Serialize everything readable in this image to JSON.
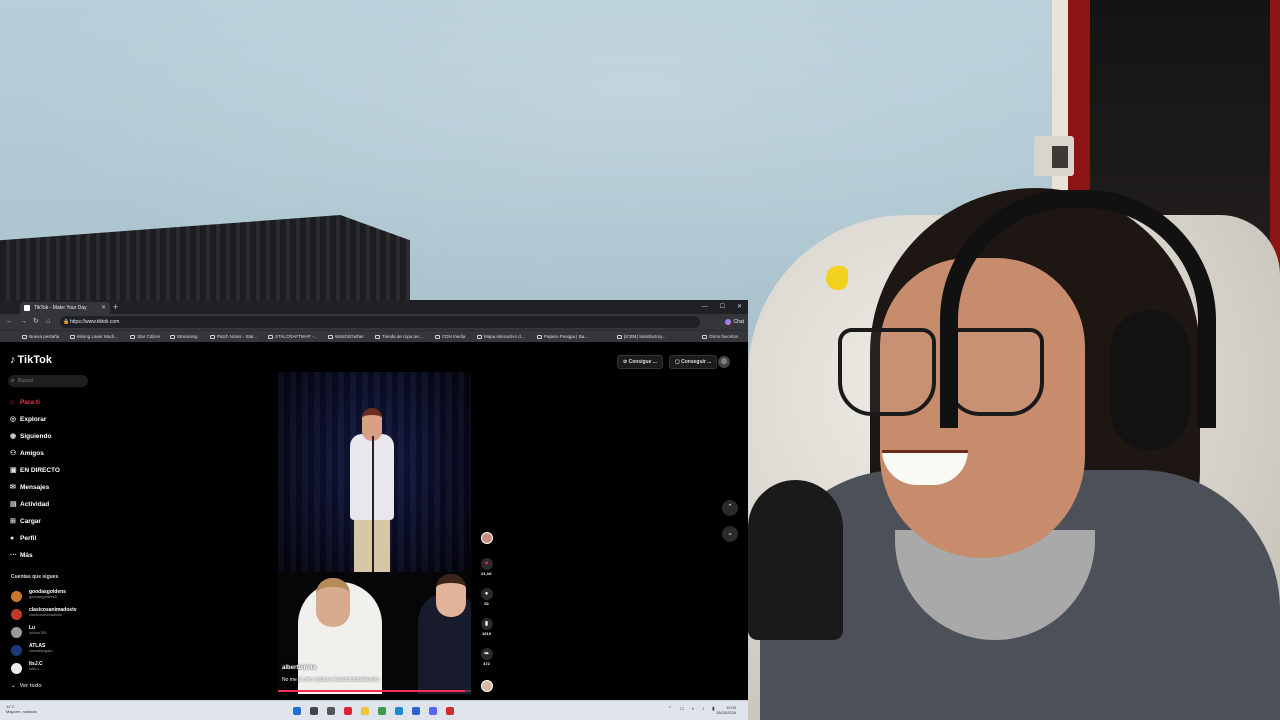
{
  "browser": {
    "tab_title": "TikTok - Make Your Day",
    "tab_close": "✕",
    "new_tab": "+",
    "url": "https://www.tiktok.com",
    "chat_label": "Chat",
    "window_controls": [
      "—",
      "☐",
      "✕"
    ],
    "bookmarks": [
      "Nueva pestaña",
      "Mining Laser Modi...",
      "Star Citizen",
      "Streaming",
      "Patch Notes - Star...",
      "STALCRAFTMAP -...",
      "Watch2Gether",
      "Tienda de ropa tec...",
      "CDN media",
      "Mapa interactivo d...",
      "Papero Pesqpa | Ba...",
      "[ICBM] Satisfactory...",
      "Otros favoritos"
    ]
  },
  "tiktok": {
    "logo": "TikTok",
    "search_placeholder": "Buscar",
    "nav": [
      {
        "label": "Para ti",
        "icon": "home-icon",
        "glyph": "⌂",
        "active": true
      },
      {
        "label": "Explorar",
        "icon": "compass-icon",
        "glyph": "◎",
        "active": false
      },
      {
        "label": "Siguiendo",
        "icon": "following-icon",
        "glyph": "◉",
        "active": false
      },
      {
        "label": "Amigos",
        "icon": "friends-icon",
        "glyph": "⚇",
        "active": false
      },
      {
        "label": "EN DIRECTO",
        "icon": "live-icon",
        "glyph": "▣",
        "active": false
      },
      {
        "label": "Mensajes",
        "icon": "messages-icon",
        "glyph": "✉",
        "active": false
      },
      {
        "label": "Actividad",
        "icon": "activity-icon",
        "glyph": "▤",
        "active": false
      },
      {
        "label": "Cargar",
        "icon": "upload-icon",
        "glyph": "⊞",
        "active": false
      },
      {
        "label": "Perfil",
        "icon": "profile-icon",
        "glyph": "●",
        "active": false
      },
      {
        "label": "Más",
        "icon": "more-icon",
        "glyph": "···",
        "active": false
      }
    ],
    "following_header": "Cuentas que sigues",
    "following": [
      {
        "name": "goodasgoldens",
        "handle": "goodasgoldens5",
        "color": "#c9792f"
      },
      {
        "name": "clasicosanimadostv",
        "handle": "clasicosanimadostv",
        "color": "#c33a2d"
      },
      {
        "name": "Lu",
        "handle": "luchun785",
        "color": "#9a9a9a"
      },
      {
        "name": "ATLAS",
        "handle": "chesatlasgatv",
        "color": "#1a3a7a"
      },
      {
        "name": "ItsJ.C",
        "handle": "mftu.c",
        "color": "#ececec"
      }
    ],
    "see_all": "Ver todo",
    "top_buttons": [
      "Consigue ...",
      "Conseguir ..."
    ],
    "video": {
      "username": "albertoimita",
      "caption": "No me lo creo todavía #estadointbailekneko",
      "progress": 0.97
    },
    "actions": [
      {
        "name": "like",
        "glyph": "♥",
        "count": "21,1K",
        "color": "#fe2c55"
      },
      {
        "name": "comment",
        "glyph": "●",
        "count": "52",
        "color": "#ffffff"
      },
      {
        "name": "save",
        "glyph": "▮",
        "count": "1610",
        "color": "#ffffff"
      },
      {
        "name": "share",
        "glyph": "➦",
        "count": "472",
        "color": "#ffffff"
      }
    ],
    "scroll_up": "⌃",
    "scroll_down": "⌄"
  },
  "taskbar": {
    "weather_temp": "11°C",
    "weather_desc": "Mayorm. nublado",
    "time": "12:00",
    "date": "28/03/2026",
    "icons": [
      {
        "name": "windows-start-icon",
        "color": "#1f6fd1"
      },
      {
        "name": "search-icon",
        "color": "#444444"
      },
      {
        "name": "task-view-icon",
        "color": "#555555"
      },
      {
        "name": "opera-icon",
        "color": "#e0213b"
      },
      {
        "name": "file-explorer-icon",
        "color": "#f0c53a"
      },
      {
        "name": "chrome-icon",
        "color": "#3c9a4a"
      },
      {
        "name": "edge-icon",
        "color": "#1a8ad1"
      },
      {
        "name": "store-icon",
        "color": "#2563c9"
      },
      {
        "name": "discord-icon",
        "color": "#5865f2"
      },
      {
        "name": "app-icon",
        "color": "#d02a2a"
      }
    ]
  }
}
